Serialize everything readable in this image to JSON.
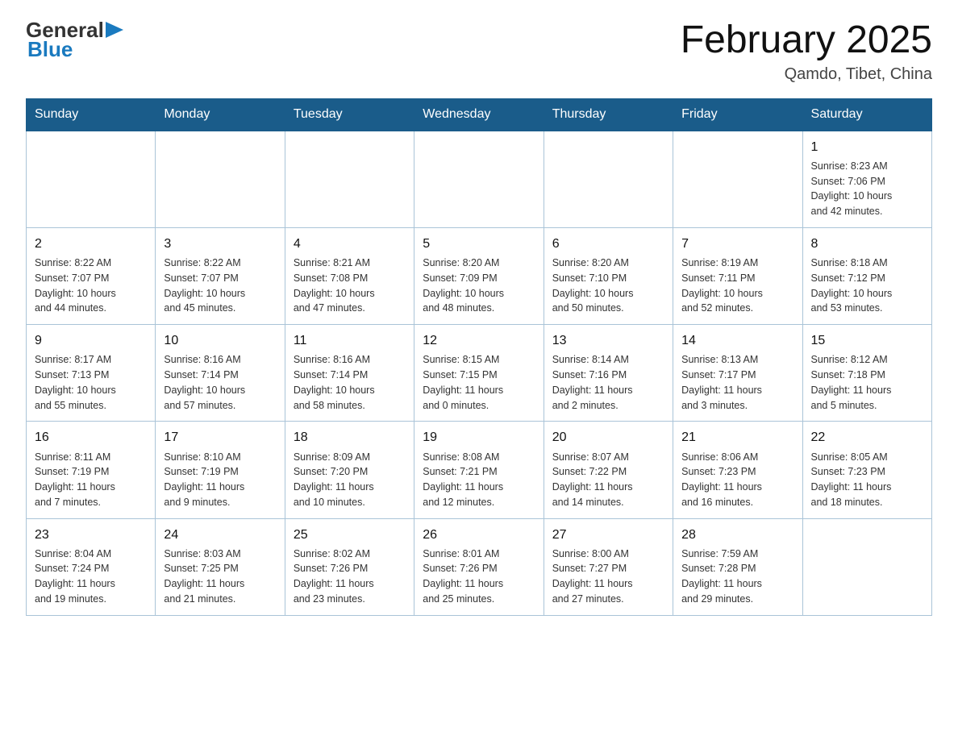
{
  "header": {
    "logo": {
      "general": "General",
      "blue": "Blue"
    },
    "title": "February 2025",
    "location": "Qamdo, Tibet, China"
  },
  "weekdays": [
    "Sunday",
    "Monday",
    "Tuesday",
    "Wednesday",
    "Thursday",
    "Friday",
    "Saturday"
  ],
  "weeks": [
    [
      {
        "day": "",
        "info": ""
      },
      {
        "day": "",
        "info": ""
      },
      {
        "day": "",
        "info": ""
      },
      {
        "day": "",
        "info": ""
      },
      {
        "day": "",
        "info": ""
      },
      {
        "day": "",
        "info": ""
      },
      {
        "day": "1",
        "info": "Sunrise: 8:23 AM\nSunset: 7:06 PM\nDaylight: 10 hours\nand 42 minutes."
      }
    ],
    [
      {
        "day": "2",
        "info": "Sunrise: 8:22 AM\nSunset: 7:07 PM\nDaylight: 10 hours\nand 44 minutes."
      },
      {
        "day": "3",
        "info": "Sunrise: 8:22 AM\nSunset: 7:07 PM\nDaylight: 10 hours\nand 45 minutes."
      },
      {
        "day": "4",
        "info": "Sunrise: 8:21 AM\nSunset: 7:08 PM\nDaylight: 10 hours\nand 47 minutes."
      },
      {
        "day": "5",
        "info": "Sunrise: 8:20 AM\nSunset: 7:09 PM\nDaylight: 10 hours\nand 48 minutes."
      },
      {
        "day": "6",
        "info": "Sunrise: 8:20 AM\nSunset: 7:10 PM\nDaylight: 10 hours\nand 50 minutes."
      },
      {
        "day": "7",
        "info": "Sunrise: 8:19 AM\nSunset: 7:11 PM\nDaylight: 10 hours\nand 52 minutes."
      },
      {
        "day": "8",
        "info": "Sunrise: 8:18 AM\nSunset: 7:12 PM\nDaylight: 10 hours\nand 53 minutes."
      }
    ],
    [
      {
        "day": "9",
        "info": "Sunrise: 8:17 AM\nSunset: 7:13 PM\nDaylight: 10 hours\nand 55 minutes."
      },
      {
        "day": "10",
        "info": "Sunrise: 8:16 AM\nSunset: 7:14 PM\nDaylight: 10 hours\nand 57 minutes."
      },
      {
        "day": "11",
        "info": "Sunrise: 8:16 AM\nSunset: 7:14 PM\nDaylight: 10 hours\nand 58 minutes."
      },
      {
        "day": "12",
        "info": "Sunrise: 8:15 AM\nSunset: 7:15 PM\nDaylight: 11 hours\nand 0 minutes."
      },
      {
        "day": "13",
        "info": "Sunrise: 8:14 AM\nSunset: 7:16 PM\nDaylight: 11 hours\nand 2 minutes."
      },
      {
        "day": "14",
        "info": "Sunrise: 8:13 AM\nSunset: 7:17 PM\nDaylight: 11 hours\nand 3 minutes."
      },
      {
        "day": "15",
        "info": "Sunrise: 8:12 AM\nSunset: 7:18 PM\nDaylight: 11 hours\nand 5 minutes."
      }
    ],
    [
      {
        "day": "16",
        "info": "Sunrise: 8:11 AM\nSunset: 7:19 PM\nDaylight: 11 hours\nand 7 minutes."
      },
      {
        "day": "17",
        "info": "Sunrise: 8:10 AM\nSunset: 7:19 PM\nDaylight: 11 hours\nand 9 minutes."
      },
      {
        "day": "18",
        "info": "Sunrise: 8:09 AM\nSunset: 7:20 PM\nDaylight: 11 hours\nand 10 minutes."
      },
      {
        "day": "19",
        "info": "Sunrise: 8:08 AM\nSunset: 7:21 PM\nDaylight: 11 hours\nand 12 minutes."
      },
      {
        "day": "20",
        "info": "Sunrise: 8:07 AM\nSunset: 7:22 PM\nDaylight: 11 hours\nand 14 minutes."
      },
      {
        "day": "21",
        "info": "Sunrise: 8:06 AM\nSunset: 7:23 PM\nDaylight: 11 hours\nand 16 minutes."
      },
      {
        "day": "22",
        "info": "Sunrise: 8:05 AM\nSunset: 7:23 PM\nDaylight: 11 hours\nand 18 minutes."
      }
    ],
    [
      {
        "day": "23",
        "info": "Sunrise: 8:04 AM\nSunset: 7:24 PM\nDaylight: 11 hours\nand 19 minutes."
      },
      {
        "day": "24",
        "info": "Sunrise: 8:03 AM\nSunset: 7:25 PM\nDaylight: 11 hours\nand 21 minutes."
      },
      {
        "day": "25",
        "info": "Sunrise: 8:02 AM\nSunset: 7:26 PM\nDaylight: 11 hours\nand 23 minutes."
      },
      {
        "day": "26",
        "info": "Sunrise: 8:01 AM\nSunset: 7:26 PM\nDaylight: 11 hours\nand 25 minutes."
      },
      {
        "day": "27",
        "info": "Sunrise: 8:00 AM\nSunset: 7:27 PM\nDaylight: 11 hours\nand 27 minutes."
      },
      {
        "day": "28",
        "info": "Sunrise: 7:59 AM\nSunset: 7:28 PM\nDaylight: 11 hours\nand 29 minutes."
      },
      {
        "day": "",
        "info": ""
      }
    ]
  ]
}
